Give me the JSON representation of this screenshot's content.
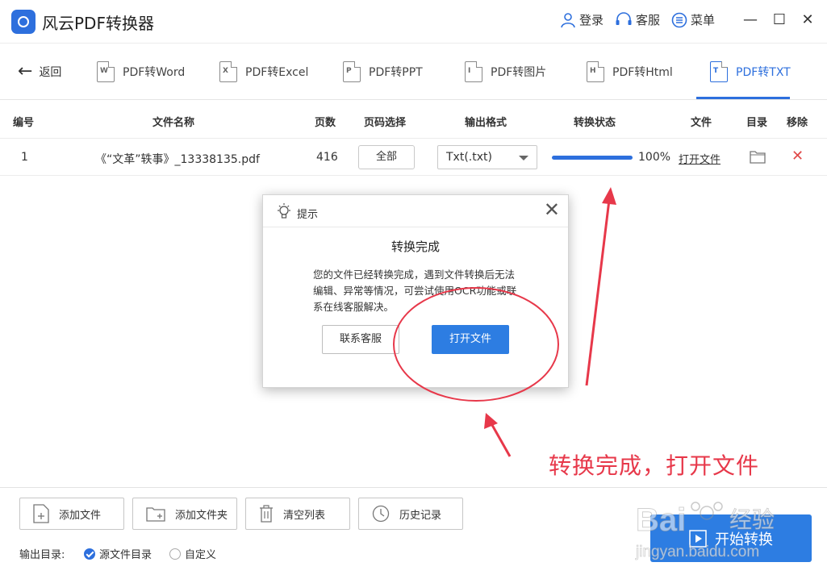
{
  "app": {
    "title": "风云PDF转换器"
  },
  "top_actions": {
    "login": "登录",
    "service": "客服",
    "menu": "菜单"
  },
  "window_controls": {
    "minimize": "—",
    "maximize": "☐",
    "close": "✕"
  },
  "nav": {
    "back": "返回",
    "tabs": [
      {
        "label": "PDF转Word",
        "badge": "W"
      },
      {
        "label": "PDF转Excel",
        "badge": "X"
      },
      {
        "label": "PDF转PPT",
        "badge": "P"
      },
      {
        "label": "PDF转图片",
        "badge": "I"
      },
      {
        "label": "PDF转Html",
        "badge": "H"
      },
      {
        "label": "PDF转TXT",
        "badge": "T",
        "active": true
      }
    ]
  },
  "table": {
    "headers": [
      "编号",
      "文件名称",
      "页数",
      "页码选择",
      "输出格式",
      "转换状态",
      "文件",
      "目录",
      "移除"
    ],
    "rows": [
      {
        "id": "1",
        "filename": "《“文革”轶事》_13338135.pdf",
        "pages": "416",
        "page_select": "全部",
        "format": "Txt(.txt)",
        "progress_percent": 100,
        "progress_label": "100%",
        "file_action": "打开文件"
      }
    ]
  },
  "dialog": {
    "header": "提示",
    "title": "转换完成",
    "body": "您的文件已经转换完成，遇到文件转换后无法编辑、异常等情况，可尝试使用OCR功能或联系在线客服解决。",
    "contact_button": "联系客服",
    "open_button": "打开文件"
  },
  "annotation": {
    "text": "转换完成，打开文件",
    "color": "#e7384a"
  },
  "bottom": {
    "buttons": [
      "添加文件",
      "添加文件夹",
      "清空列表",
      "历史记录"
    ],
    "output_label": "输出目录:",
    "options": [
      {
        "label": "源文件目录",
        "checked": true
      },
      {
        "label": "自定义",
        "checked": false
      }
    ],
    "start": "开始转换"
  },
  "watermark": {
    "brand": "Bai",
    "brand2": "经验",
    "url": "jingyan.baidu.com"
  },
  "colors": {
    "accent": "#2d6fdd",
    "annotation": "#e7384a",
    "remove": "#e04848"
  }
}
